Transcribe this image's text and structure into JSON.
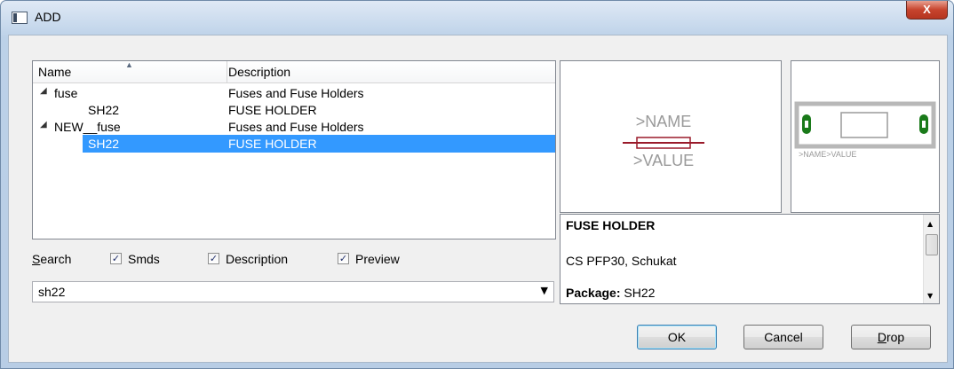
{
  "window": {
    "title": "ADD",
    "close_label": "X"
  },
  "tree": {
    "columns": {
      "name": "Name",
      "description": "Description"
    },
    "rows": [
      {
        "name": "fuse",
        "description": "Fuses and Fuse Holders"
      },
      {
        "name": "SH22",
        "description": "FUSE HOLDER"
      },
      {
        "name": "NEW__fuse",
        "description": "Fuses and Fuse Holders"
      },
      {
        "name": "SH22",
        "description": "FUSE HOLDER"
      }
    ]
  },
  "search": {
    "label": "Search",
    "options": [
      {
        "label": "Smds",
        "checked": true
      },
      {
        "label": "Description",
        "checked": true
      },
      {
        "label": "Preview",
        "checked": true
      }
    ],
    "value": "sh22"
  },
  "symbol_preview": {
    "name_text": ">NAME",
    "value_text": ">VALUE"
  },
  "package_preview": {
    "label_text": ">NAME>VALUE"
  },
  "info": {
    "title": "FUSE HOLDER",
    "subtitle": "CS PFP30, Schukat",
    "package_label": "Package:",
    "package_value": "SH22"
  },
  "buttons": {
    "ok": "OK",
    "cancel": "Cancel",
    "drop": "Drop"
  },
  "colors": {
    "selection": "#3399ff",
    "symbol": "#9a1a2a",
    "pad": "#1a7a1a"
  }
}
